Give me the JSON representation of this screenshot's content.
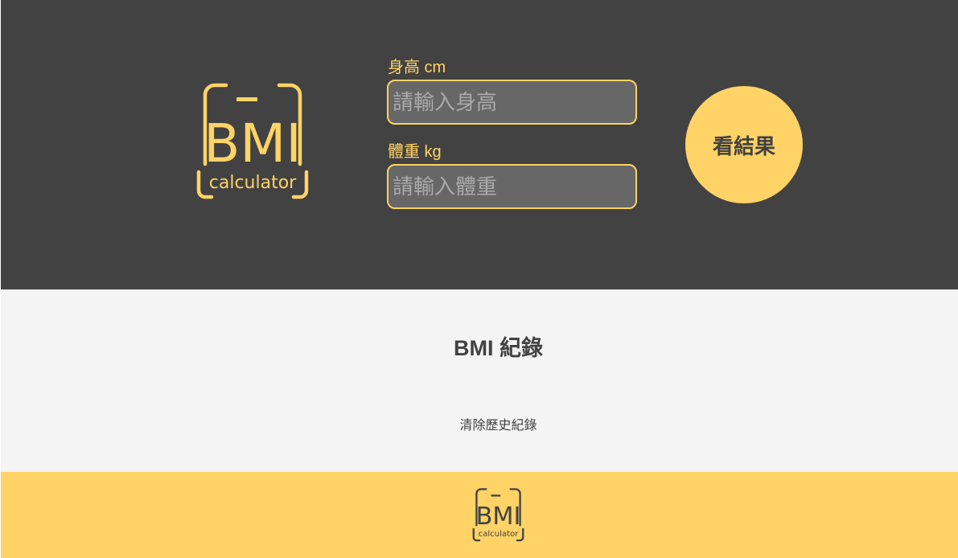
{
  "app": {
    "logo": {
      "main_text": "BMI",
      "sub_text": "calculator",
      "icon": "bmi-scale-logo"
    }
  },
  "form": {
    "height_label": "身高 cm",
    "height_placeholder": "請輸入身高",
    "height_value": "",
    "weight_label": "體重 kg",
    "weight_placeholder": "請輸入體重",
    "weight_value": "",
    "submit_label": "看結果"
  },
  "records": {
    "title": "BMI 紀錄",
    "clear_label": "清除歷史紀錄"
  },
  "footer": {
    "logo": {
      "main_text": "BMI",
      "sub_text": "calculator",
      "icon": "bmi-scale-logo"
    }
  },
  "colors": {
    "accent": "#ffd366",
    "header_bg": "#424242",
    "records_bg": "#f4f4f4",
    "input_bg": "#676767",
    "text_dark": "#424242"
  }
}
